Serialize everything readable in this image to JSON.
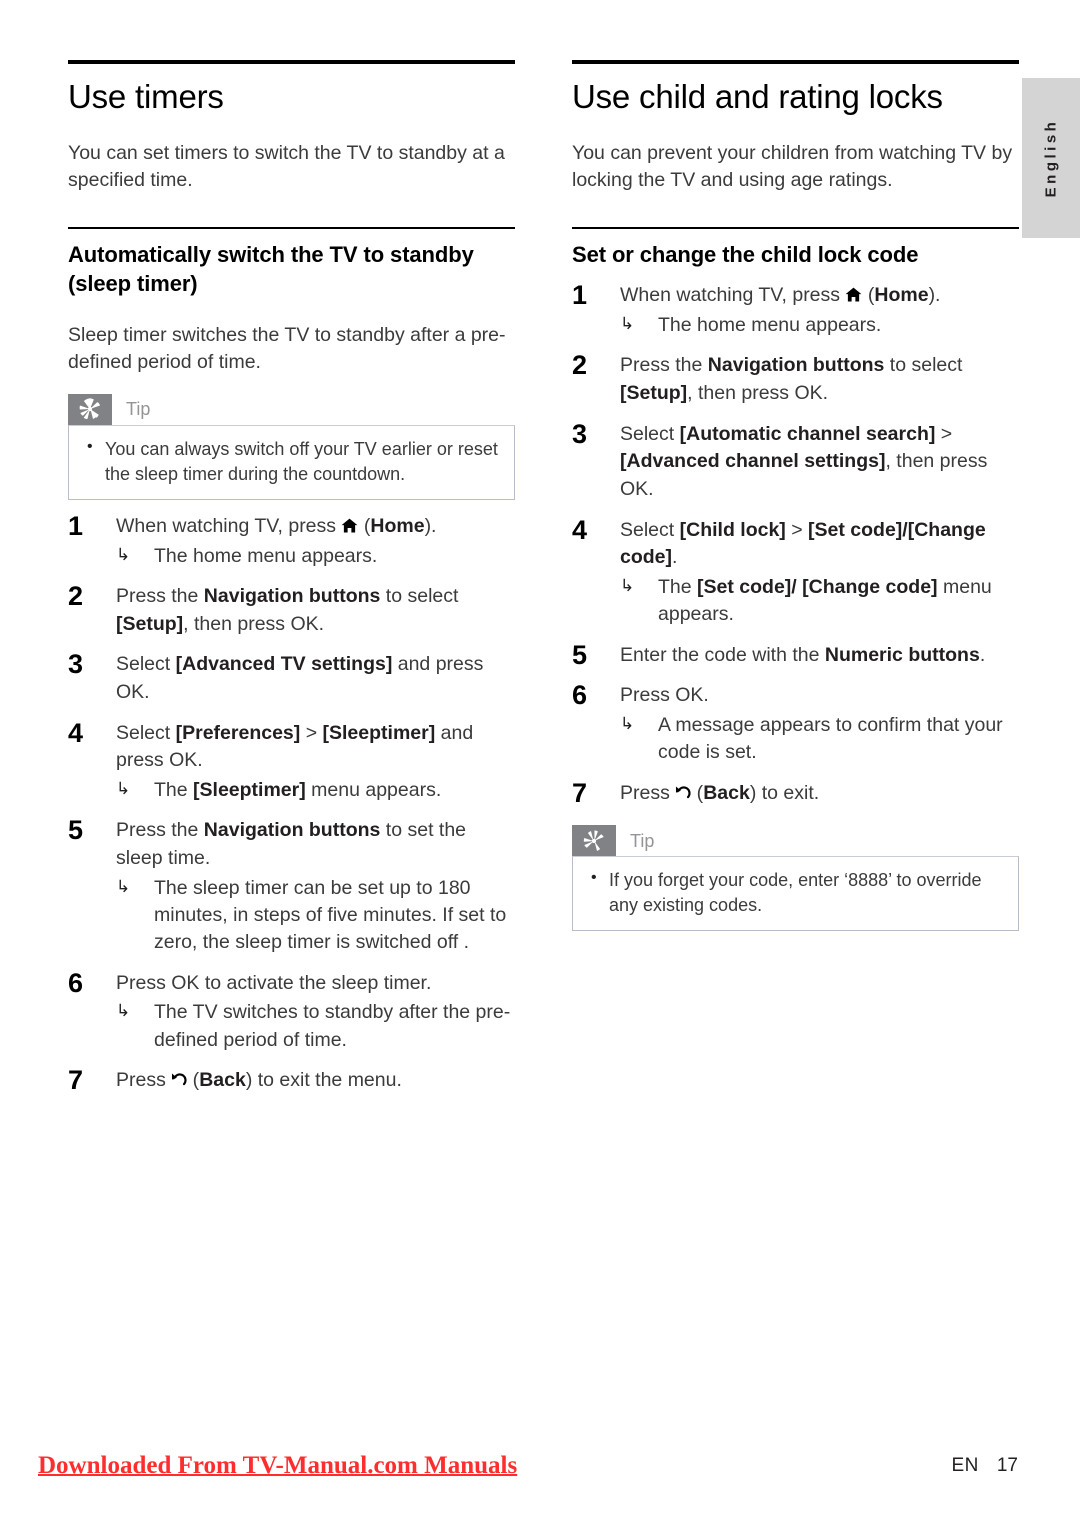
{
  "language_tab": {
    "label": "English"
  },
  "left_column": {
    "chapter_title": "Use timers",
    "intro": "You can set timers to switch the TV to standby at a specified time.",
    "section_title": "Automatically switch the TV to standby (sleep timer)",
    "section_intro": "Sleep timer switches the TV to standby after a pre-defined period of time.",
    "tip": {
      "label": "Tip",
      "icon": "asterisk-icon",
      "items": [
        "You can always switch off your TV earlier or reset the sleep timer during the countdown."
      ]
    },
    "steps": [
      {
        "num": "1",
        "text_before": "When watching TV, press ",
        "glyph": "home-icon",
        "text_after_open": " (",
        "bold": "Home",
        "text_after": ").",
        "results": [
          "The home menu appears."
        ]
      },
      {
        "num": "2",
        "segments": [
          {
            "t": "Press the ",
            "b": false
          },
          {
            "t": "Navigation buttons",
            "b": true
          },
          {
            "t": " to select ",
            "b": false
          },
          {
            "t": "[Setup]",
            "b": true
          },
          {
            "t": ", then press ",
            "b": false
          },
          {
            "t": "OK",
            "b": false
          },
          {
            "t": ".",
            "b": false
          }
        ],
        "results": []
      },
      {
        "num": "3",
        "segments": [
          {
            "t": "Select ",
            "b": false
          },
          {
            "t": "[Advanced TV settings]",
            "b": true
          },
          {
            "t": " and press OK.",
            "b": false
          }
        ],
        "results": []
      },
      {
        "num": "4",
        "segments": [
          {
            "t": "Select ",
            "b": false
          },
          {
            "t": "[Preferences]",
            "b": true
          },
          {
            "t": " > ",
            "b": false
          },
          {
            "t": "[Sleeptimer]",
            "b": true
          },
          {
            "t": " and press OK.",
            "b": false
          }
        ],
        "results": [
          "The [Sleeptimer] menu appears."
        ],
        "result_bold": "[Sleeptimer]"
      },
      {
        "num": "5",
        "segments": [
          {
            "t": "Press the ",
            "b": false
          },
          {
            "t": "Navigation buttons",
            "b": true
          },
          {
            "t": " to set the sleep time.",
            "b": false
          }
        ],
        "results": [
          "The sleep timer can be set up to 180 minutes, in steps of five minutes. If set to zero, the sleep timer is switched off ."
        ]
      },
      {
        "num": "6",
        "segments": [
          {
            "t": "Press OK to activate the sleep timer.",
            "b": false
          }
        ],
        "results": [
          "The TV switches to standby after the pre-defined period of time."
        ]
      },
      {
        "num": "7",
        "glyph_back": "back-icon",
        "text_before": "Press ",
        "text_after_open": " (",
        "bold": "Back",
        "text_after": ") to exit the menu.",
        "results": []
      }
    ]
  },
  "right_column": {
    "chapter_title": "Use child and rating locks",
    "intro": "You can prevent your children from watching TV by locking the TV and using age ratings.",
    "section_title": "Set or change the child lock code",
    "tip": {
      "label": "Tip",
      "icon": "asterisk-icon",
      "items": [
        "If you forget your code, enter ‘8888’ to override any existing codes."
      ]
    },
    "steps": [
      {
        "num": "1",
        "text_before": "When watching TV, press ",
        "glyph": "home-icon",
        "text_after_open": " (",
        "bold": "Home",
        "text_after": ").",
        "results": [
          "The home menu appears."
        ]
      },
      {
        "num": "2",
        "segments": [
          {
            "t": "Press the ",
            "b": false
          },
          {
            "t": "Navigation buttons",
            "b": true
          },
          {
            "t": " to select ",
            "b": false
          },
          {
            "t": "[Setup]",
            "b": true
          },
          {
            "t": ", then press OK.",
            "b": false
          }
        ],
        "results": []
      },
      {
        "num": "3",
        "segments": [
          {
            "t": "Select ",
            "b": false
          },
          {
            "t": "[Automatic channel search]",
            "b": true
          },
          {
            "t": " > ",
            "b": false
          },
          {
            "t": "[Advanced channel settings]",
            "b": true
          },
          {
            "t": ", then press OK.",
            "b": false
          }
        ],
        "results": []
      },
      {
        "num": "4",
        "segments": [
          {
            "t": "Select ",
            "b": false
          },
          {
            "t": "[Child lock]",
            "b": true
          },
          {
            "t": " > ",
            "b": false
          },
          {
            "t": "[Set code]/[Change code]",
            "b": true
          },
          {
            "t": ".",
            "b": false
          }
        ],
        "results": [
          "The [Set code]/ [Change code] menu appears."
        ],
        "result_bold": "[Set code]/ [Change code]"
      },
      {
        "num": "5",
        "segments": [
          {
            "t": "Enter the code with the ",
            "b": false
          },
          {
            "t": "Numeric buttons",
            "b": true
          },
          {
            "t": ".",
            "b": false
          }
        ],
        "results": []
      },
      {
        "num": "6",
        "segments": [
          {
            "t": "Press OK.",
            "b": false
          }
        ],
        "results": [
          "A message appears to confirm that your code is set."
        ]
      },
      {
        "num": "7",
        "glyph_back": "back-icon",
        "text_before": "Press ",
        "text_after_open": " (",
        "bold": "Back",
        "text_after": ") to exit.",
        "results": []
      }
    ]
  },
  "footer": {
    "watermark": "Downloaded From TV-Manual.com Manuals",
    "lang_code": "EN",
    "page_number": "17"
  },
  "colors": {
    "tip_icon_bg": "#808285",
    "tip_label": "#939598",
    "tip_border": "#b9bdc9",
    "lang_tab_bg": "#d4d4d4",
    "watermark_red": "#ff2d2d",
    "rule_black": "#000000",
    "body_text": "#3b3b3b"
  }
}
